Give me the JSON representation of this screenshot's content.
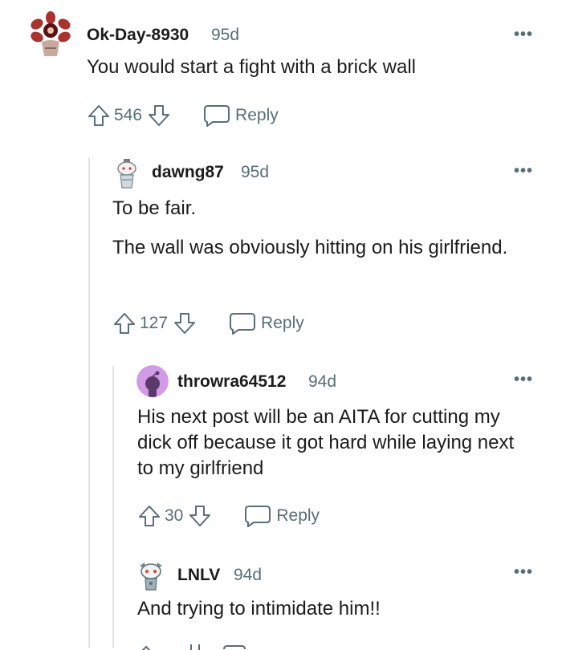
{
  "comments": [
    {
      "username": "Ok-Day-8930",
      "age": "95d",
      "body": [
        "You would start a fight with a brick wall"
      ],
      "score": "546",
      "reply_label": "Reply",
      "more_label": "•••"
    },
    {
      "username": "dawng87",
      "age": "95d",
      "body": [
        "To be fair.",
        "The wall was obviously hitting on his girlfriend."
      ],
      "score": "127",
      "reply_label": "Reply",
      "more_label": "•••"
    },
    {
      "username": "throwra64512",
      "age": "94d",
      "body": [
        "His next post will be an AITA for cutting my dick off because it got hard while laying next to my girlfriend"
      ],
      "score": "30",
      "reply_label": "Reply",
      "more_label": "•••"
    },
    {
      "username": "LNLV",
      "age": "94d",
      "body": [
        "And trying to intimidate him!!"
      ],
      "more_label": "•••"
    }
  ],
  "icons": {
    "upvote": "upvote-arrow-icon",
    "downvote": "downvote-arrow-icon",
    "reply": "speech-bubble-icon",
    "more": "more-options-icon"
  },
  "colors": {
    "text": "#1c1c1c",
    "meta": "#576f76",
    "thread_line": "#e0e4e6",
    "avatar_purple": "#d29be6"
  }
}
